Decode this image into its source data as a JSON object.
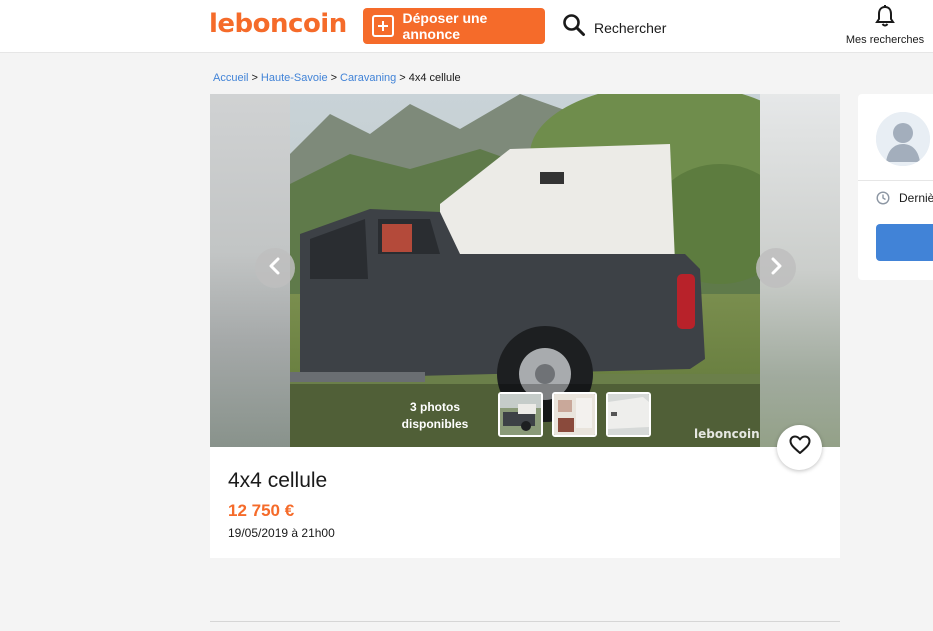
{
  "header": {
    "logo": "leboncoin",
    "deposit_label": "Déposer une annonce",
    "search_label": "Rechercher",
    "saved_searches_label": "Mes recherches"
  },
  "breadcrumb": {
    "items": [
      "Accueil",
      "Haute-Savoie",
      "Caravaning"
    ],
    "current": "4x4 cellule"
  },
  "gallery": {
    "photo_count_line1": "3 photos",
    "photo_count_line2": "disponibles",
    "watermark": "leboncoin"
  },
  "ad": {
    "title": "4x4 cellule",
    "price": "12 750 €",
    "date": "19/05/2019 à 21h00"
  },
  "seller": {
    "last_seen_label": "Derniè"
  },
  "colors": {
    "brand": "#f56b2a",
    "link": "#4183d7",
    "background": "#f4f4f4"
  }
}
